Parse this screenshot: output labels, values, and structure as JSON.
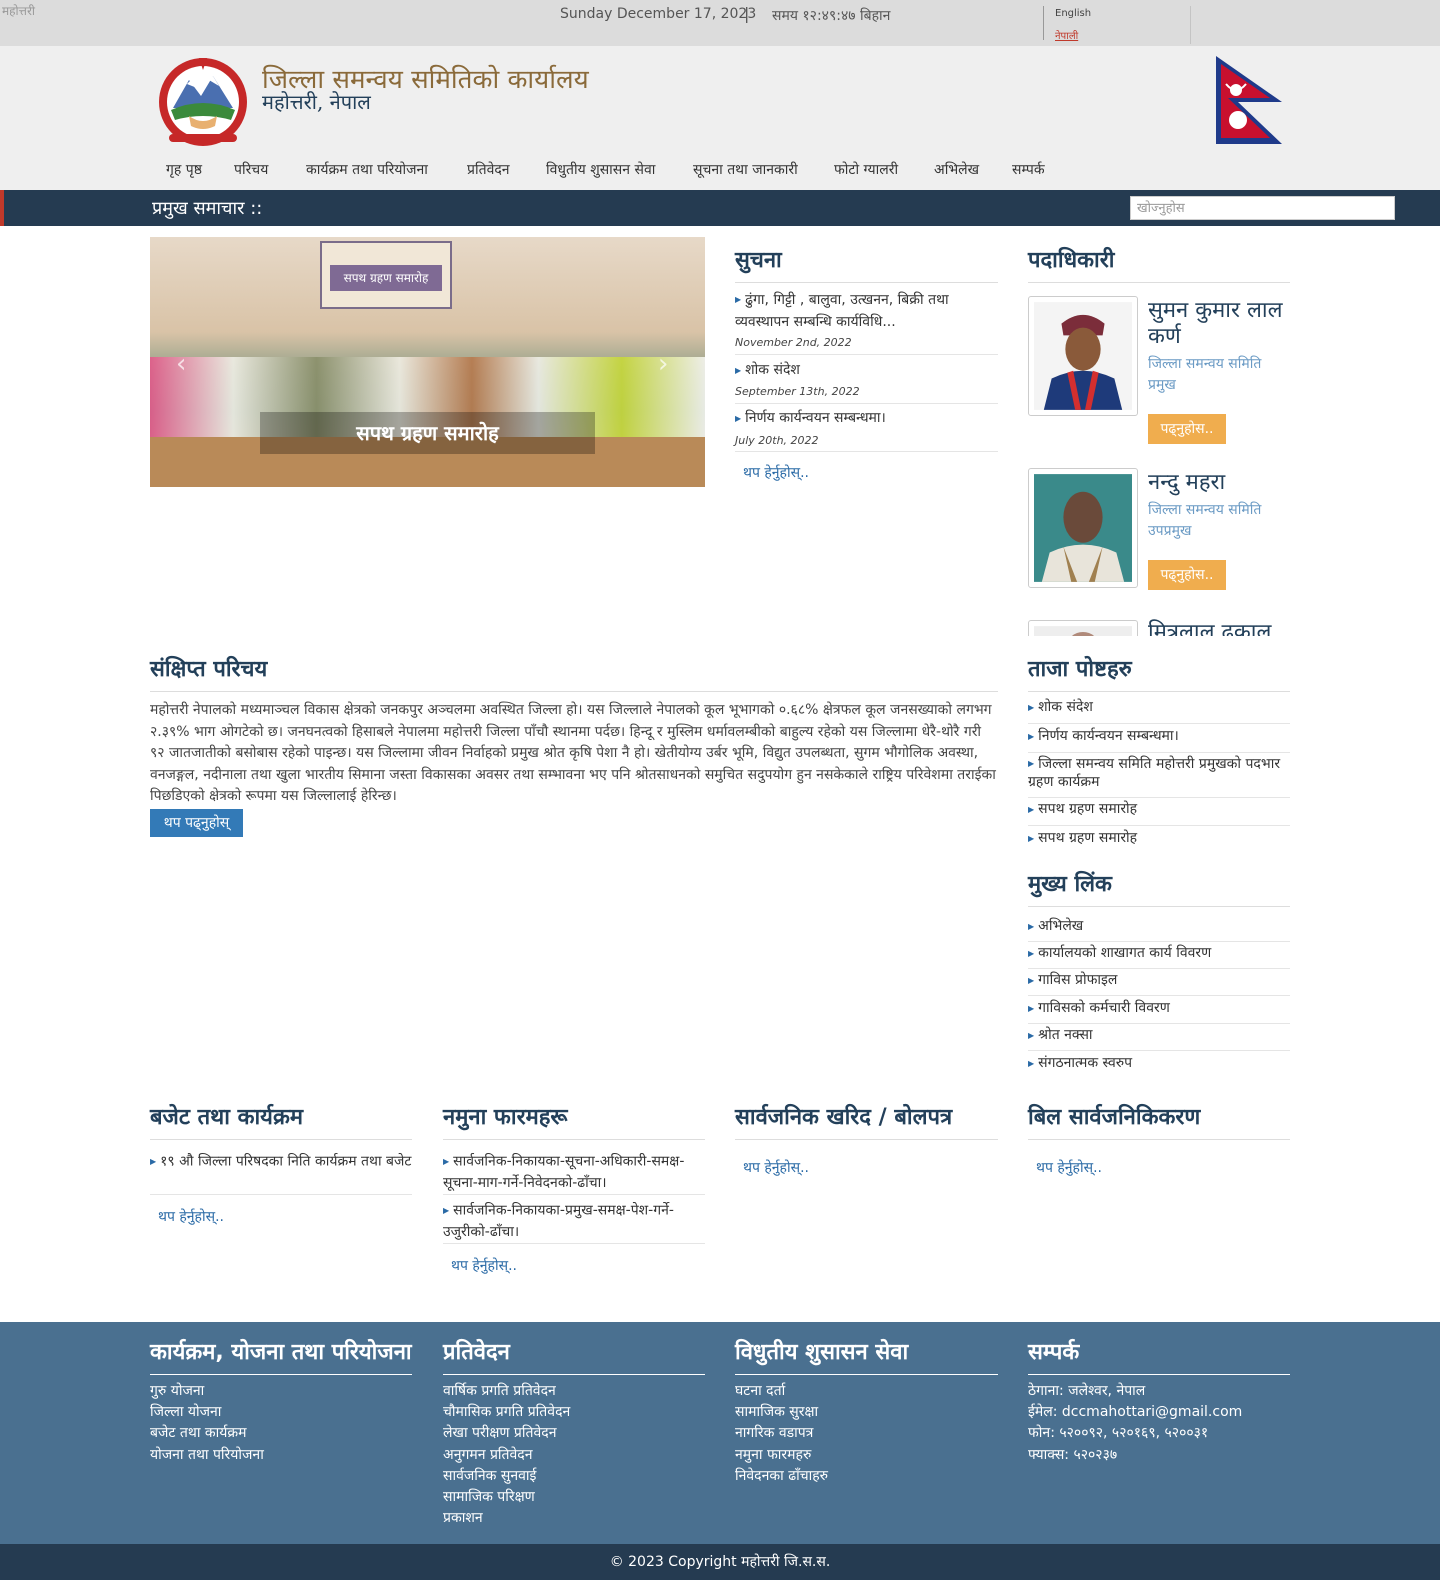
{
  "topbar": {
    "broken_image_alt": "महोत्तरी",
    "date": "Sunday December 17, 2023",
    "separator": "|",
    "time": "समय १२:४९:४७ बिहान",
    "lang_english": "English",
    "lang_nepali": "नेपाली"
  },
  "header": {
    "title": "जिल्ला समन्वय समितिको कार्यालय",
    "subtitle": "महोत्तरी, नेपाल"
  },
  "nav": [
    "गृह पृष्ठ",
    "परिचय",
    "कार्यक्रम तथा परियोजना",
    "प्रतिवेदन",
    "विधुतीय शुसासन सेवा",
    "सूचना तथा जानकारी",
    "फोटो ग्यालरी",
    "अभिलेख",
    "सम्पर्क"
  ],
  "newsbar": {
    "label": "प्रमुख समाचार ::",
    "search_placeholder": "खोज्नुहोस"
  },
  "slider": {
    "banner": "सपथ ग्रहण समारोह",
    "caption": "सपथ ग्रहण समारोह",
    "prev": "‹",
    "next": "›"
  },
  "notices": {
    "heading": "सुचना",
    "items": [
      {
        "title": "ढुंगा, गिट्टी , बालुवा, उत्खनन, बिक्री तथा व्यवस्थापन सम्बन्धि कार्यविधि...",
        "date": "November 2nd, 2022"
      },
      {
        "title": "शोक संदेश",
        "date": "September 13th, 2022"
      },
      {
        "title": "निर्णय कार्यन्वयन सम्बन्धमा।",
        "date": "July 20th, 2022"
      }
    ],
    "more": "थप हेर्नुहोस्.."
  },
  "officials": {
    "heading": "पदाधिकारी",
    "items": [
      {
        "name": "सुमन कुमार लाल कर्ण",
        "role": "जिल्ला समन्वय समिति प्रमुख",
        "button": "पढ्नुहोस.."
      },
      {
        "name": "नन्दु महरा",
        "role": "जिल्ला समन्वय समिति उपप्रमुख",
        "button": "पढ्नुहोस.."
      },
      {
        "name": "मित्रलाल ढकाल",
        "role": "",
        "button": ""
      }
    ]
  },
  "intro": {
    "heading": "संक्षिप्त परिचय",
    "text": "महोत्तरी नेपालको मध्यमाञ्चल विकास क्षेत्रको जनकपुर अञ्चलमा अवस्थित जिल्ला हो। यस जिल्लाले नेपालको कूल भूभागको ०.६८% क्षेत्रफल कूल जनसख्याको लगभग २.३९% भाग ओगटेको छ। जनघनत्वको हिसाबले नेपालमा महोत्तरी जिल्ला पाँचौ स्थानमा पर्दछ। हिन्दू र मुस्लिम धर्मावलम्बीको बाहुल्य रहेको यस जिल्लामा धेरै-थोरै गरी ९२ जातजातीको बसोबास रहेको पाइन्छ। यस जिल्लामा जीवन निर्वाहको प्रमुख श्रोत कृषि पेशा नै हो। खेतीयोग्य उर्बर भूमि, विद्युत उपलब्धता, सुगम भौगोलिक अवस्था, वनजङ्गल, नदीनाला तथा खुला भारतीय सिमाना जस्ता विकासका अवसर तथा सम्भावना भए पनि श्रोतसाधनको समुचित सदुपयोग हुन नसकेकाले राष्ट्रिय परिवेशमा तराईका पिछडिएको क्षेत्रको रूपमा यस जिल्लालाई हेरिन्छ।",
    "button": "थप पढ्नुहोस्"
  },
  "recent_posts": {
    "heading": "ताजा पोष्टहरु",
    "items": [
      "शोक संदेश",
      "निर्णय कार्यन्वयन सम्बन्धमा।",
      "जिल्ला समन्वय समिति महोत्तरी प्रमुखको पदभार ग्रहण कार्यक्रम",
      "सपथ ग्रहण समारोह",
      "सपथ ग्रहण समारोह"
    ]
  },
  "main_links": {
    "heading": "मुख्य लिंक",
    "items": [
      "अभिलेख",
      "कार्यालयको शाखागत कार्य विवरण",
      "गाविस प्रोफाइल",
      "गाविसको कर्मचारी विवरण",
      "श्रोत नक्सा",
      "संगठनात्मक स्वरुप"
    ]
  },
  "budget": {
    "heading": "बजेट तथा कार्यक्रम",
    "items": [
      "१९ औ जिल्ला परिषदका निति कार्यक्रम तथा बजेट"
    ],
    "more": "थप हेर्नुहोस्.."
  },
  "forms": {
    "heading": "नमुना फारमहरू",
    "items": [
      "सार्वजनिक-निकायका-सूचना-अधिकारी-समक्ष-सूचना-माग-गर्ने-निवेदनको-ढाँचा।",
      "सार्वजनिक-निकायका-प्रमुख-समक्ष-पेश-गर्ने-उजुरीको-ढाँचा।"
    ],
    "more": "थप हेर्नुहोस्.."
  },
  "procurement": {
    "heading": "सार्वजनिक खरिद / बोलपत्र",
    "more": "थप हेर्नुहोस्.."
  },
  "bills": {
    "heading": "बिल सार्वजनिकिकरण",
    "more": "थप हेर्नुहोस्.."
  },
  "footer": {
    "cols": [
      {
        "heading": "कार्यक्रम, योजना तथा परियोजना",
        "links": [
          "गुरु योजना",
          "जिल्ला योजना",
          "बजेट तथा कार्यक्रम",
          "योजना तथा परियोजना"
        ]
      },
      {
        "heading": "प्रतिवेदन",
        "links": [
          "वार्षिक प्रगति प्रतिवेदन",
          "चौमासिक प्रगति प्रतिवेदन",
          "लेखा परीक्षण प्रतिवेदन",
          "अनुगमन प्रतिवेदन",
          "सार्वजनिक सुनवाई",
          "सामाजिक परिक्षण",
          "प्रकाशन"
        ]
      },
      {
        "heading": "विधुतीय शुसासन सेवा",
        "links": [
          "घटना दर्ता",
          "सामाजिक सुरक्षा",
          "नागरिक वडापत्र",
          "नमुना फारमहरु",
          "निवेदनका ढाँचाहरु"
        ]
      },
      {
        "heading": "सम्पर्क",
        "links": [
          "ठेगाना: जलेश्वर, नेपाल",
          "ईमेल: dccmahottari@gmail.com",
          "फोन: ५२००९२, ५२०१६९, ५२००३१",
          "फ्याक्स: ५२०२३७"
        ]
      }
    ],
    "copyright": "© 2023 Copyright महोत्तरी जि.स.स."
  },
  "colors": {
    "primary_dark": "#253b51",
    "footer_bg": "#4a7090",
    "heading": "#23405a",
    "title_gold": "#8a6a3a",
    "button_orange": "#f0ad4e",
    "button_blue": "#337ab7",
    "accent_red": "#c0392b"
  }
}
